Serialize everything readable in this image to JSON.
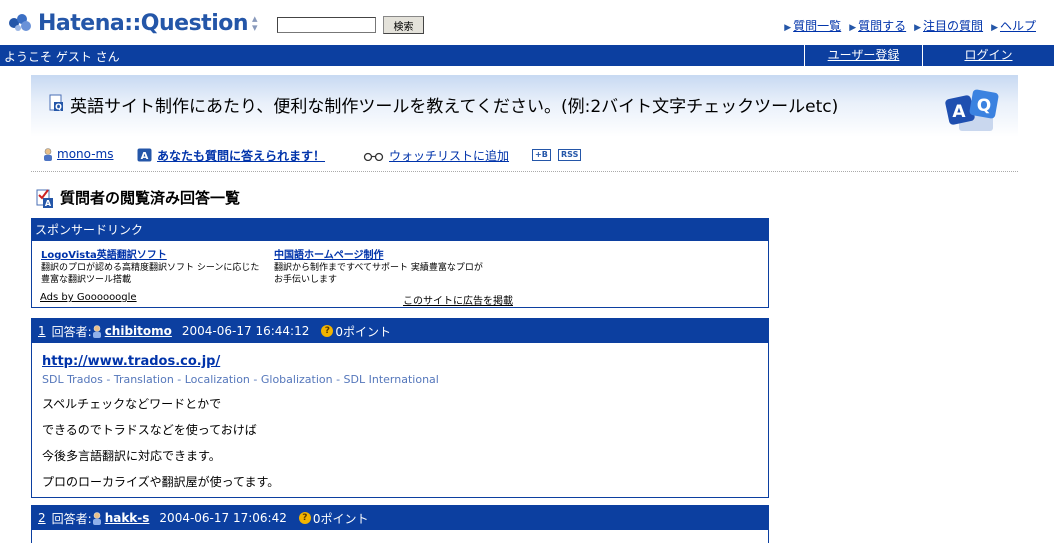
{
  "header": {
    "logo_text": "Hatena::Question",
    "search": {
      "value": "",
      "placeholder": ""
    },
    "search_button": "検索",
    "nav": [
      {
        "label": "質問一覧"
      },
      {
        "label": "質問する"
      },
      {
        "label": "注目の質問"
      },
      {
        "label": "ヘルプ"
      }
    ]
  },
  "userbar": {
    "welcome": "ようこそ ゲスト さん",
    "register": "ユーザー登録",
    "login": "ログイン"
  },
  "question": {
    "title": "英語サイト制作にあたり、便利な制作ツールを教えてください。(例:2バイト文字チェックツールetc)"
  },
  "actions": {
    "user": "mono-ms",
    "answer_prompt": "あなたも質問に答えられます！",
    "watchlist": "ウォッチリストに追加",
    "bookmark_badge": "+B",
    "rss_badge": "RSS"
  },
  "section": {
    "title": "質問者の閲覧済み回答一覧"
  },
  "sponsor": {
    "heading": "スポンサードリンク",
    "ads": [
      {
        "title": "LogoVista英語翻訳ソフト",
        "line1": "翻訳のプロが認める高精度翻訳ソフト シーンに応じた",
        "line2": "豊富な翻訳ツール搭載"
      },
      {
        "title": "中国語ホームページ制作",
        "line1": "翻訳から制作まですべてサポート 実績豊富なプロが",
        "line2": "お手伝いします"
      }
    ],
    "ads_by": "Ads by Goooooogle",
    "advertise": "このサイトに広告を掲載"
  },
  "answers": [
    {
      "number": "1",
      "label": "回答者:",
      "user": "chibitomo",
      "date": "2004-06-17 16:44:12",
      "points": "0ポイント",
      "url": "http://www.trados.co.jp/",
      "url_desc": "SDL Trados - Translation - Localization - Globalization - SDL International",
      "lines": [
        "スペルチェックなどワードとかで",
        "できるのでトラドスなどを使っておけば",
        "今後多言語翻訳に対応できます。",
        "プロのローカライズや翻訳屋が使ってます。"
      ]
    },
    {
      "number": "2",
      "label": "回答者:",
      "user": "hakk-s",
      "date": "2004-06-17 17:06:42",
      "points": "0ポイント"
    }
  ],
  "colors": {
    "brand_blue": "#0c3fa0",
    "link": "#0033aa",
    "logo": "#2456a8",
    "point_badge": "#f2b400"
  },
  "icons": [
    "hatena-bird-icon",
    "question-doc-icon",
    "aq-logo-icon",
    "person-icon",
    "answer-a-icon",
    "glasses-icon",
    "point-coin-icon",
    "checked-answer-icon"
  ]
}
